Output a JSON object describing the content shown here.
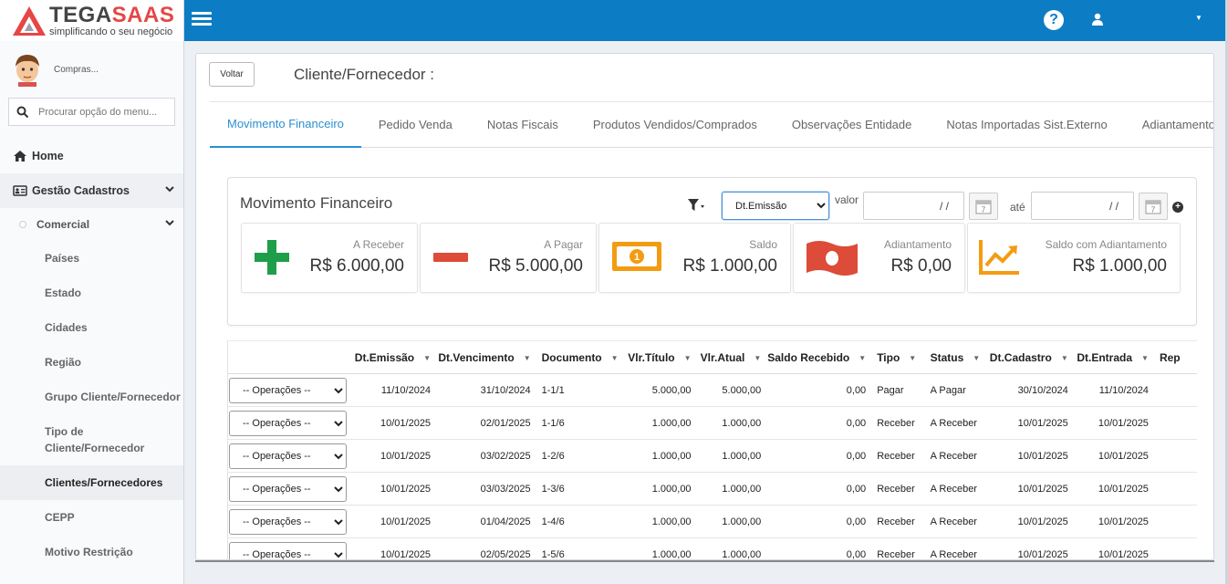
{
  "brand": {
    "name_part1": "TEGA",
    "name_part2": "SAAS",
    "tagline": "simplificando o seu negócio"
  },
  "user": {
    "name": "Compras..."
  },
  "search": {
    "placeholder": "Procurar opção do menu..."
  },
  "sidebar": {
    "home": "Home",
    "group": "Gestão Cadastros",
    "subgroup": "Comercial",
    "items": [
      "Países",
      "Estado",
      "Cidades",
      "Região",
      "Grupo Cliente/Fornecedor",
      "Tipo de Cliente/Fornecedor",
      "Clientes/Fornecedores",
      "CEPP",
      "Motivo Restrição"
    ]
  },
  "topbar": {
    "help_label": "?"
  },
  "header": {
    "back_label": "Voltar",
    "title": "Cliente/Fornecedor :"
  },
  "tabs": [
    "Movimento Financeiro",
    "Pedido Venda",
    "Notas Fiscais",
    "Produtos Vendidos/Comprados",
    "Observações Entidade",
    "Notas Importadas Sist.Externo",
    "Adiantamento"
  ],
  "panel": {
    "title": "Movimento Financeiro",
    "date_select": "Dt.Emissão",
    "valor_label": "valor",
    "date_from": "/ /",
    "ate_label": "até",
    "date_to": "/ /",
    "add_label": "+"
  },
  "cards": [
    {
      "label": "A Receber",
      "value": "R$ 6.000,00",
      "color": "#1e9e4a"
    },
    {
      "label": "A Pagar",
      "value": "R$ 5.000,00",
      "color": "#dd4b39"
    },
    {
      "label": "Saldo",
      "value": "R$ 1.000,00",
      "color": "#f39c12"
    },
    {
      "label": "Adiantamento",
      "value": "R$ 0,00",
      "color": "#dd4b39"
    },
    {
      "label": "Saldo com Adiantamento",
      "value": "R$ 1.000,00",
      "color": "#f39c12"
    }
  ],
  "table": {
    "ops_label": "-- Operações --",
    "columns": [
      "Dt.Emissão",
      "Dt.Vencimento",
      "Documento",
      "Vlr.Título",
      "Vlr.Atual",
      "Saldo Recebido",
      "Tipo",
      "Status",
      "Dt.Cadastro",
      "Dt.Entrada",
      "Rep"
    ],
    "rows": [
      [
        "11/10/2024",
        "31/10/2024",
        "1-1/1",
        "5.000,00",
        "5.000,00",
        "0,00",
        "Pagar",
        "A Pagar",
        "30/10/2024",
        "11/10/2024"
      ],
      [
        "10/01/2025",
        "02/01/2025",
        "1-1/6",
        "1.000,00",
        "1.000,00",
        "0,00",
        "Receber",
        "A Receber",
        "10/01/2025",
        "10/01/2025"
      ],
      [
        "10/01/2025",
        "03/02/2025",
        "1-2/6",
        "1.000,00",
        "1.000,00",
        "0,00",
        "Receber",
        "A Receber",
        "10/01/2025",
        "10/01/2025"
      ],
      [
        "10/01/2025",
        "03/03/2025",
        "1-3/6",
        "1.000,00",
        "1.000,00",
        "0,00",
        "Receber",
        "A Receber",
        "10/01/2025",
        "10/01/2025"
      ],
      [
        "10/01/2025",
        "01/04/2025",
        "1-4/6",
        "1.000,00",
        "1.000,00",
        "0,00",
        "Receber",
        "A Receber",
        "10/01/2025",
        "10/01/2025"
      ],
      [
        "10/01/2025",
        "02/05/2025",
        "1-5/6",
        "1.000,00",
        "1.000,00",
        "0,00",
        "Receber",
        "A Receber",
        "10/01/2025",
        "10/01/2025"
      ]
    ]
  }
}
